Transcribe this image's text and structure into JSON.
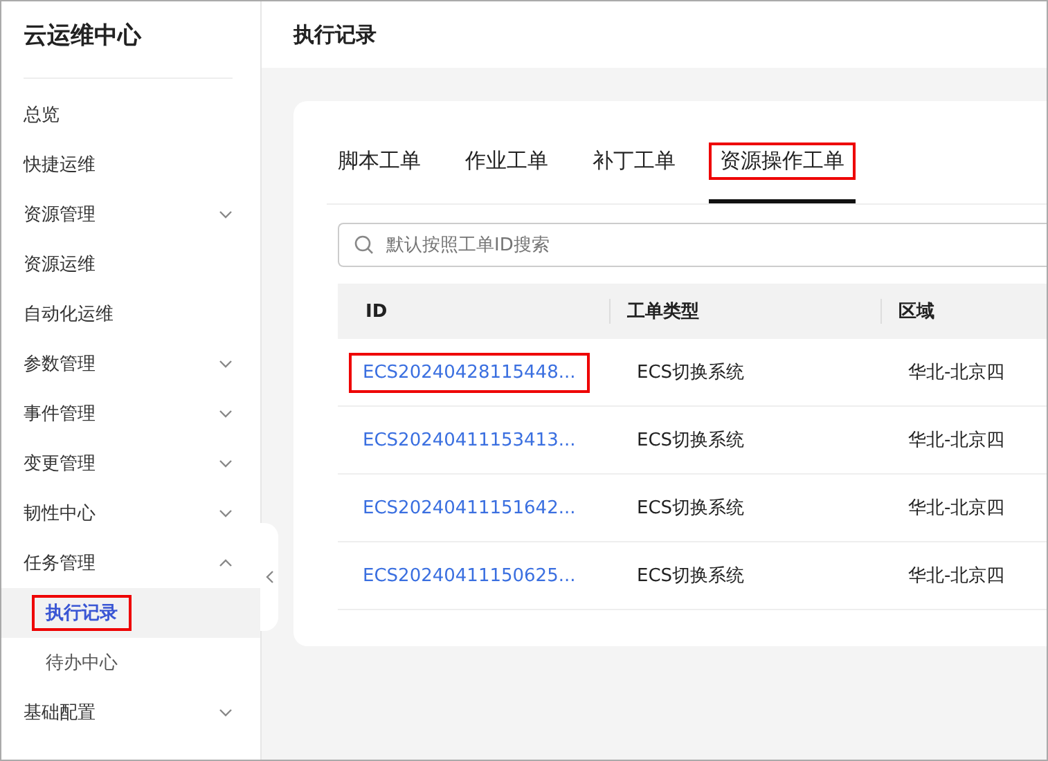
{
  "sidebar": {
    "title": "云运维中心",
    "items": [
      {
        "label": "总览",
        "kind": "link",
        "selected": false,
        "highlighted": false
      },
      {
        "label": "快捷运维",
        "kind": "link",
        "selected": false,
        "highlighted": false
      },
      {
        "label": "资源管理",
        "kind": "group",
        "expanded": false,
        "selected": false,
        "highlighted": false
      },
      {
        "label": "资源运维",
        "kind": "link",
        "selected": false,
        "highlighted": false
      },
      {
        "label": "自动化运维",
        "kind": "link",
        "selected": false,
        "highlighted": false
      },
      {
        "label": "参数管理",
        "kind": "group",
        "expanded": false,
        "selected": false,
        "highlighted": false
      },
      {
        "label": "事件管理",
        "kind": "group",
        "expanded": false,
        "selected": false,
        "highlighted": false
      },
      {
        "label": "变更管理",
        "kind": "group",
        "expanded": false,
        "selected": false,
        "highlighted": false
      },
      {
        "label": "韧性中心",
        "kind": "group",
        "expanded": false,
        "selected": false,
        "highlighted": false
      },
      {
        "label": "任务管理",
        "kind": "group",
        "expanded": true,
        "selected": false,
        "highlighted": false,
        "children": [
          {
            "label": "执行记录",
            "selected": true,
            "highlighted": true
          },
          {
            "label": "待办中心",
            "selected": false,
            "highlighted": false
          }
        ]
      },
      {
        "label": "基础配置",
        "kind": "group",
        "expanded": false,
        "selected": false,
        "highlighted": false
      }
    ]
  },
  "header": {
    "title": "执行记录"
  },
  "tabs": [
    {
      "label": "脚本工单",
      "selected": false,
      "highlighted": false
    },
    {
      "label": "作业工单",
      "selected": false,
      "highlighted": false
    },
    {
      "label": "补丁工单",
      "selected": false,
      "highlighted": false
    },
    {
      "label": "资源操作工单",
      "selected": true,
      "highlighted": true
    }
  ],
  "search": {
    "placeholder": "默认按照工单ID搜索"
  },
  "table": {
    "columns": [
      "ID",
      "工单类型",
      "区域"
    ],
    "rows": [
      {
        "id": "ECS20240428115448...",
        "type": "ECS切换系统",
        "region": "华北-北京四",
        "highlighted": true
      },
      {
        "id": "ECS20240411153413...",
        "type": "ECS切换系统",
        "region": "华北-北京四",
        "highlighted": false
      },
      {
        "id": "ECS20240411151642...",
        "type": "ECS切换系统",
        "region": "华北-北京四",
        "highlighted": false
      },
      {
        "id": "ECS20240411150625...",
        "type": "ECS切换系统",
        "region": "华北-北京四",
        "highlighted": false
      }
    ]
  }
}
